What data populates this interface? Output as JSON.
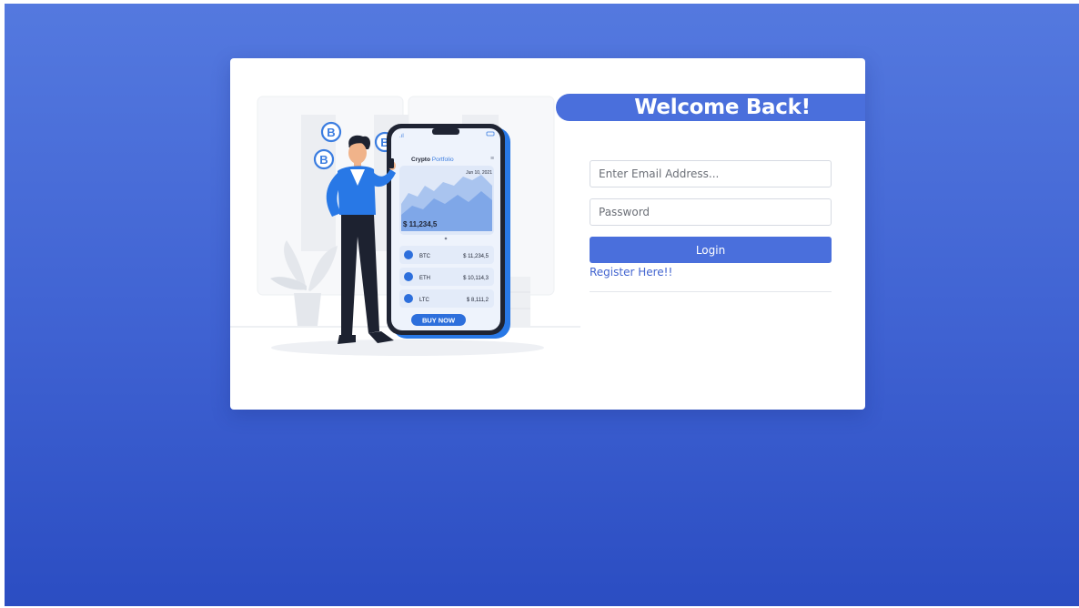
{
  "login": {
    "heading": "Welcome Back!",
    "email_placeholder": "Enter Email Address...",
    "password_placeholder": "Password",
    "login_label": "Login",
    "register_label": "Register Here!!"
  },
  "illustration": {
    "phone_title_bold": "Crypto",
    "phone_title_rest": " Portfolio",
    "date": "Jun 10, 2021",
    "balance": "$ 11,234,5",
    "coins": [
      {
        "symbol": "BTC",
        "value": "$ 11,234,5"
      },
      {
        "symbol": "ETH",
        "value": "$ 10,114,3"
      },
      {
        "symbol": "LTC",
        "value": "$ 8,111,2"
      }
    ],
    "buy_label": "BUY NOW",
    "coin_badge": "B"
  },
  "colors": {
    "accent": "#4a6fdc",
    "background_top": "#5479df",
    "background_bottom": "#2b4dc2"
  }
}
